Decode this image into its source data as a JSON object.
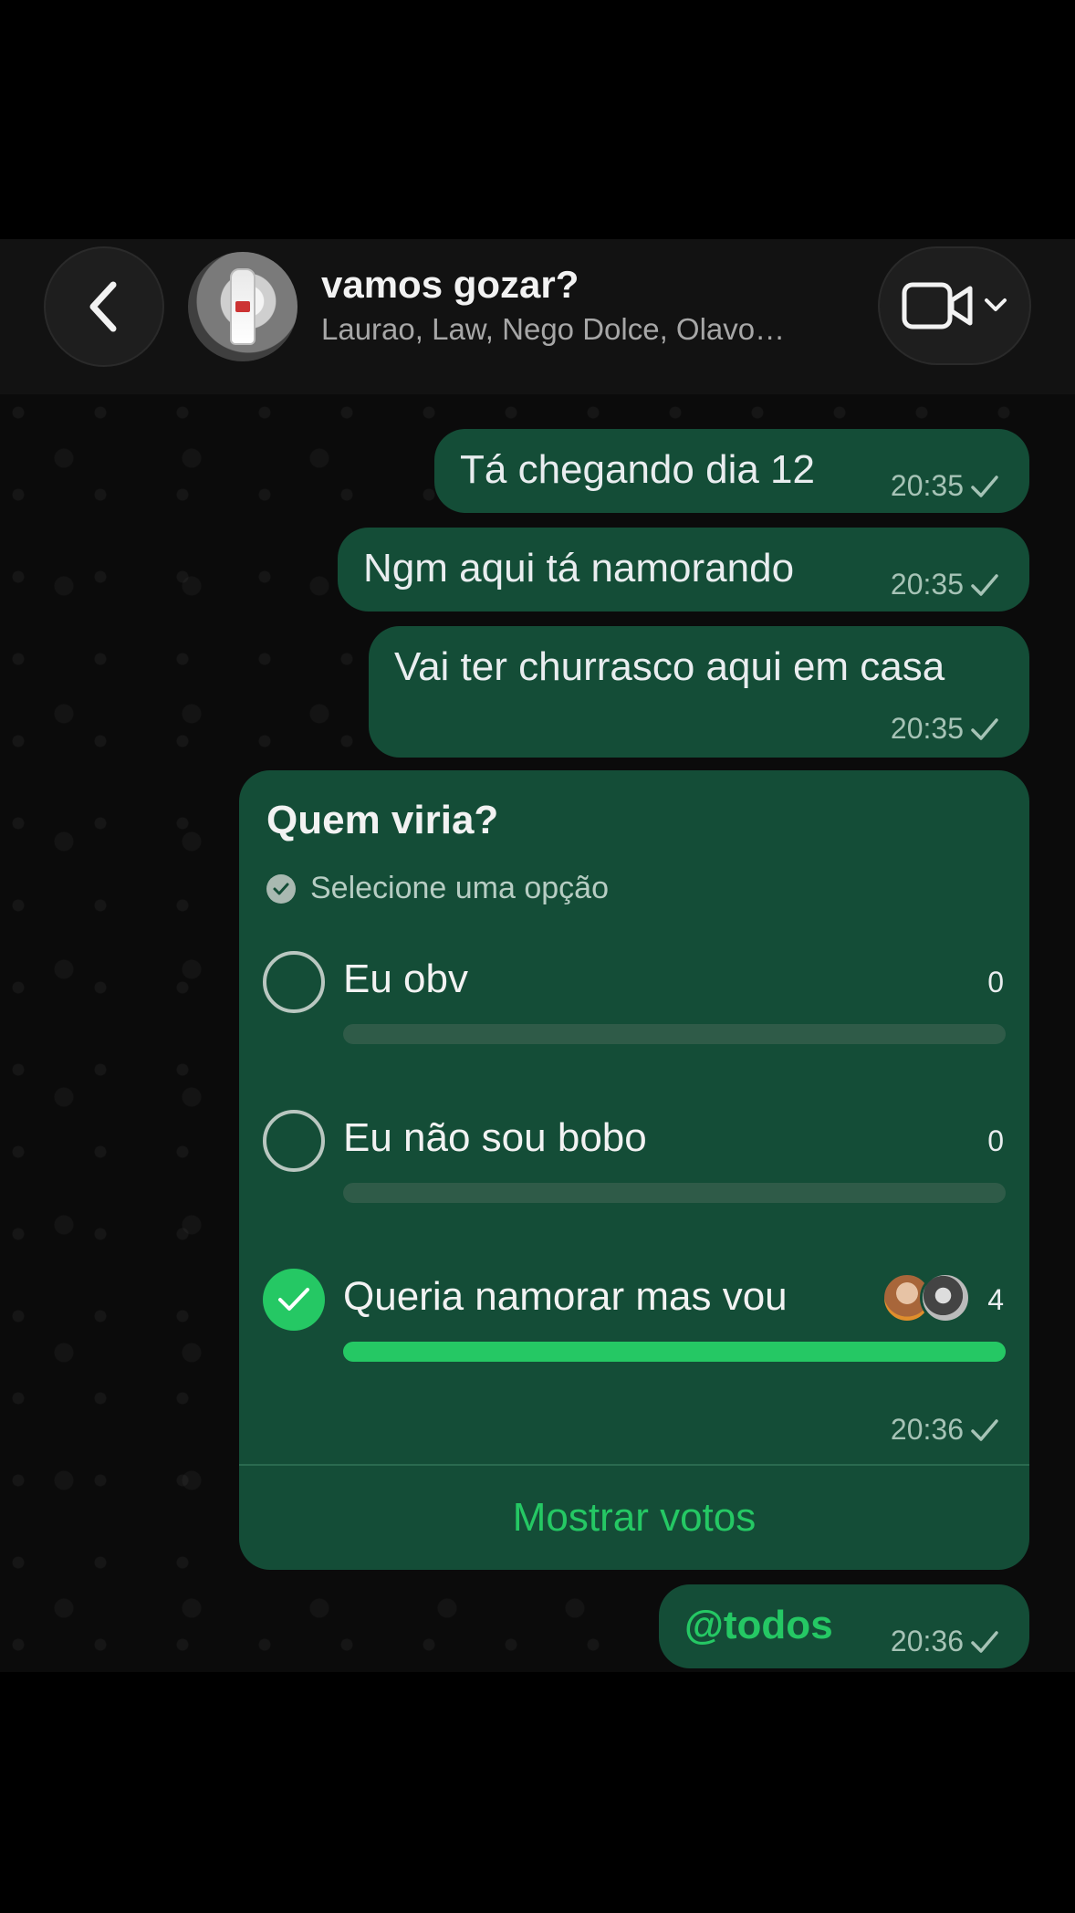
{
  "header": {
    "title": "vamos gozar?",
    "subtitle": "Laurao, Law, Nego Dolce, Olavo…",
    "back_icon": "chevron-left-icon",
    "video_icon": "video-camera-icon",
    "video_dropdown_icon": "chevron-down-icon"
  },
  "messages": [
    {
      "text": "Tá chegando dia 12",
      "time": "20:35"
    },
    {
      "text": "Ngm aqui tá namorando",
      "time": "20:35"
    },
    {
      "text": "Vai ter churrasco aqui em casa",
      "time": "20:35"
    }
  ],
  "poll": {
    "question": "Quem viria?",
    "hint": "Selecione uma opção",
    "options": [
      {
        "label": "Eu obv",
        "count": "0",
        "checked": false,
        "fraction": 0
      },
      {
        "label": "Eu não sou bobo",
        "count": "0",
        "checked": false,
        "fraction": 0
      },
      {
        "label": "Queria namorar mas vou",
        "count": "4",
        "checked": true,
        "fraction": 1
      }
    ],
    "time": "20:36",
    "show_votes": "Mostrar votos"
  },
  "last_message": {
    "text": "@todos",
    "time": "20:36"
  },
  "colors": {
    "bubble": "#144d37",
    "accent": "#25c864",
    "background": "#0b0b0b"
  }
}
